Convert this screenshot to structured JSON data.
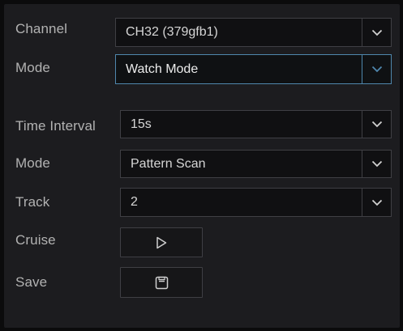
{
  "form": {
    "channel": {
      "label": "Channel",
      "value": "CH32 (379gfb1)"
    },
    "mode_top": {
      "label": "Mode",
      "value": "Watch Mode"
    },
    "time_interval": {
      "label": "Time Interval",
      "value": "15s"
    },
    "mode": {
      "label": "Mode",
      "value": "Pattern Scan"
    },
    "track": {
      "label": "Track",
      "value": "2"
    },
    "cruise": {
      "label": "Cruise",
      "icon": "play-icon"
    },
    "save": {
      "label": "Save",
      "icon": "save-icon"
    }
  },
  "colors": {
    "panel_bg": "#1c1c1f",
    "field_bg": "#101012",
    "field_border": "#3f3f44",
    "focus_border": "#4f87ad",
    "label_text": "#b2b2b2",
    "value_text": "#d6d6d6"
  }
}
